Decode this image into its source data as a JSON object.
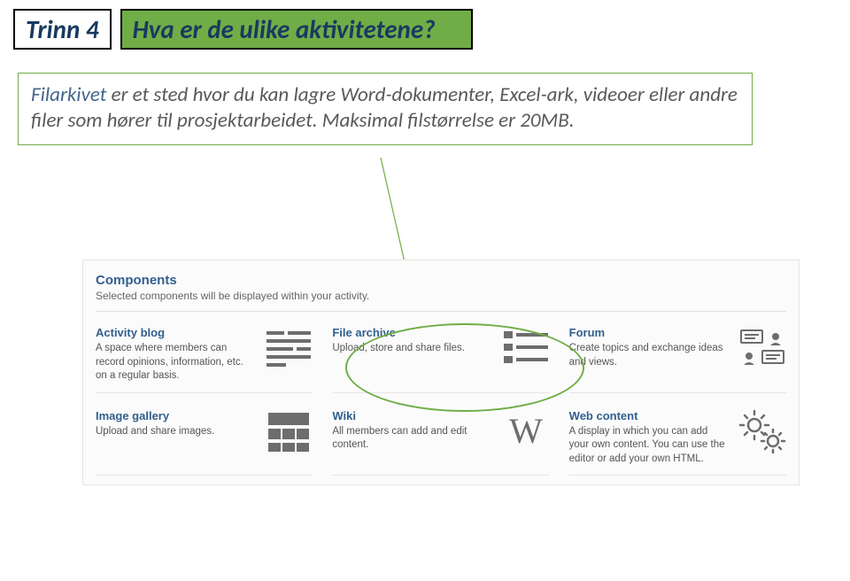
{
  "header": {
    "step_label": "Trinn 4",
    "question": "Hva er de ulike aktivitetene?"
  },
  "callout": {
    "lead": "Filarkivet",
    "body": " er et sted hvor du kan lagre Word-dokumenter, Excel-ark, videoer eller andre filer som hører til prosjektarbeidet. Maksimal filstørrelse er 20MB."
  },
  "panel": {
    "title": "Components",
    "subtitle": "Selected components will be displayed within your activity."
  },
  "components": [
    {
      "title": "Activity blog",
      "desc": "A space where members can record opinions, information, etc. on a regular basis.",
      "icon": "text-lines"
    },
    {
      "title": "File archive",
      "desc": "Upload, store and share files.",
      "icon": "list-lines"
    },
    {
      "title": "Forum",
      "desc": "Create topics and exchange ideas and views.",
      "icon": "forum"
    },
    {
      "title": "Image gallery",
      "desc": "Upload and share images.",
      "icon": "gallery"
    },
    {
      "title": "Wiki",
      "desc": "All members can add and edit content.",
      "icon": "wiki"
    },
    {
      "title": "Web content",
      "desc": "A display in which you can add your own content. You can use the editor or add your own HTML.",
      "icon": "gears"
    }
  ]
}
